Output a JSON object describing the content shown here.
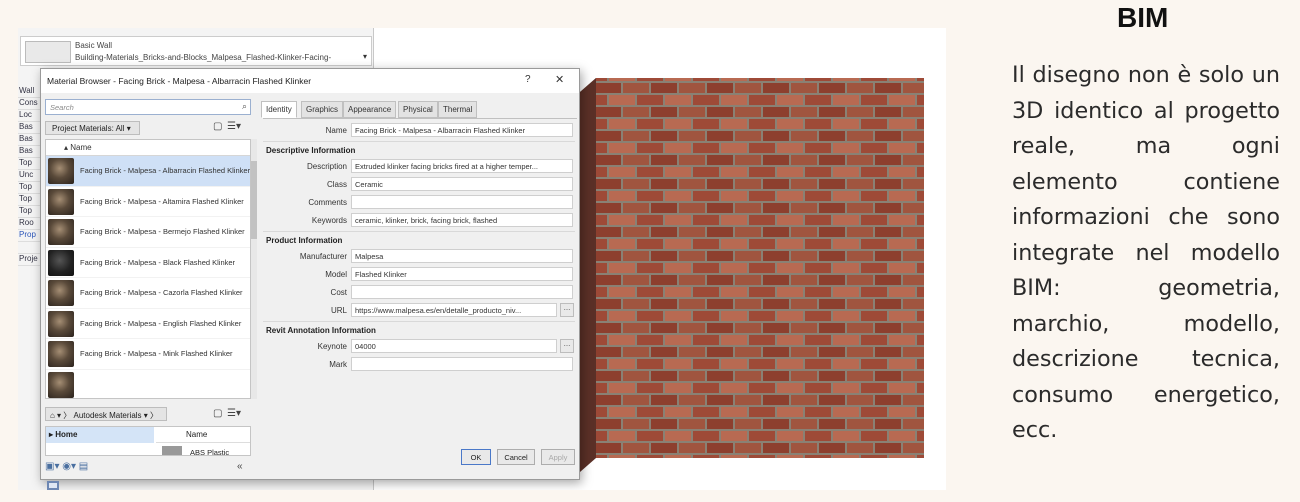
{
  "revit_properties": {
    "type_family": "Basic Wall",
    "type_name": "Building-Materials_Bricks-and-Blocks_Malpesa_Flashed-Klinker-Facing-",
    "side_stubs": [
      "Wall",
      "Cons",
      "Loc",
      "Bas",
      "Bas",
      "Bas",
      "Top",
      "Unc",
      "Top",
      "Top",
      "Top",
      "Roo",
      "Prop",
      "",
      "Proje"
    ]
  },
  "dialog": {
    "title": "Material Browser - Facing Brick - Malpesa - Albarracin Flashed Klinker",
    "help": "?",
    "close": "✕",
    "search_placeholder": "Search",
    "project_materials_label": "Project Materials: All",
    "name_column": "Name",
    "materials": [
      "Facing Brick - Malpesa - Albarracin Flashed Klinker",
      "Facing Brick - Malpesa - Altamira Flashed Klinker",
      "Facing Brick - Malpesa - Bermejo Flashed Klinker",
      "Facing Brick - Malpesa - Black Flashed Klinker",
      "Facing Brick - Malpesa - Cazorla Flashed Klinker",
      "Facing Brick - Malpesa - English Flashed Klinker",
      "Facing Brick - Malpesa - Mink Flashed Klinker"
    ],
    "library_label": "Autodesk Materials",
    "library_home": "Home",
    "library_name_column": "Name",
    "library_item": "ABS Plastic",
    "tabs": [
      "Identity",
      "Graphics",
      "Appearance",
      "Physical",
      "Thermal"
    ],
    "identity": {
      "name_label": "Name",
      "name_value": "Facing Brick - Malpesa - Albarracin Flashed Klinker",
      "descriptive_header": "Descriptive Information",
      "description_label": "Description",
      "description_value": "Extruded klinker facing bricks fired at a higher temper...",
      "class_label": "Class",
      "class_value": "Ceramic",
      "comments_label": "Comments",
      "comments_value": "",
      "keywords_label": "Keywords",
      "keywords_value": "ceramic, klinker, brick, facing brick, flashed",
      "product_header": "Product Information",
      "manufacturer_label": "Manufacturer",
      "manufacturer_value": "Malpesa",
      "model_label": "Model",
      "model_value": "Flashed Klinker",
      "cost_label": "Cost",
      "cost_value": "",
      "url_label": "URL",
      "url_value": "https://www.malpesa.es/en/detalle_producto_niv...",
      "annotation_header": "Revit Annotation Information",
      "keynote_label": "Keynote",
      "keynote_value": "04000",
      "mark_label": "Mark",
      "mark_value": ""
    },
    "ok_label": "OK",
    "cancel_label": "Cancel",
    "apply_label": "Apply"
  },
  "side_text": {
    "title": "BIM",
    "body": "Il disegno non è solo un 3D identico al progetto reale, ma ogni elemento contiene informazioni che sono integrate nel modello BIM: geometria, marchio, modello, descrizione tecnica, consumo energetico, ecc."
  }
}
